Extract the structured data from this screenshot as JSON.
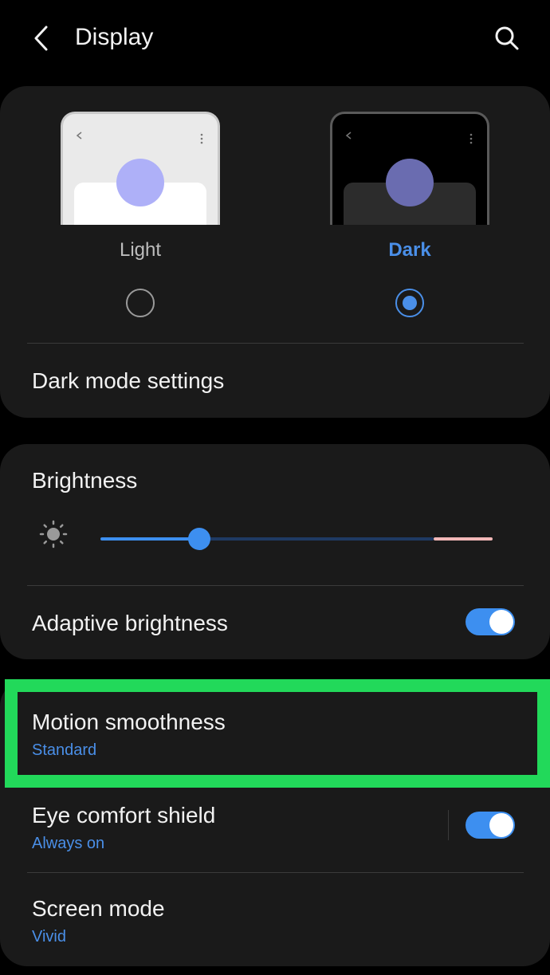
{
  "header": {
    "title": "Display",
    "back_icon": "chevron-left-icon",
    "search_icon": "search-icon"
  },
  "theme": {
    "light_label": "Light",
    "dark_label": "Dark",
    "selected": "Dark",
    "dark_mode_settings": "Dark mode settings"
  },
  "brightness": {
    "label": "Brightness",
    "level_fraction": 0.25,
    "adaptive_label": "Adaptive brightness",
    "adaptive_on": true
  },
  "settings": {
    "motion_title": "Motion smoothness",
    "motion_sub": "Standard",
    "eye_title": "Eye comfort shield",
    "eye_sub": "Always on",
    "eye_on": true,
    "screen_title": "Screen mode",
    "screen_sub": "Vivid"
  },
  "colors": {
    "accent": "#3d8ff0",
    "highlight": "#22d95a",
    "card": "#1a1a1a"
  }
}
